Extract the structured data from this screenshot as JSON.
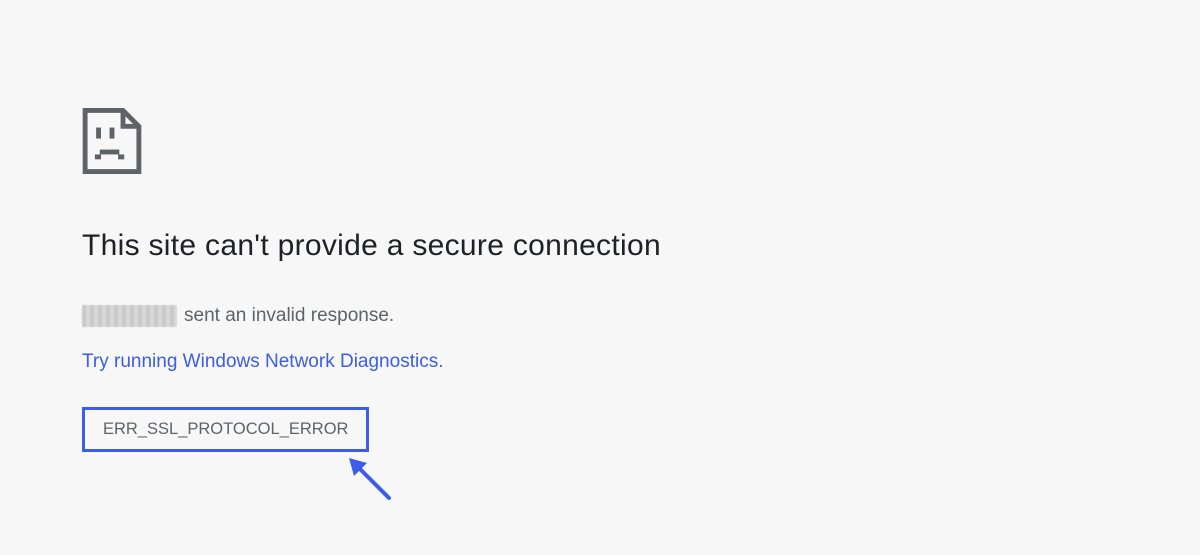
{
  "error": {
    "title": "This site can't provide a secure connection",
    "host_placeholder": "",
    "invalid_response_text": "sent an invalid response.",
    "diagnostics_link": "Try running Windows Network Diagnostics.",
    "code": "ERR_SSL_PROTOCOL_ERROR"
  }
}
